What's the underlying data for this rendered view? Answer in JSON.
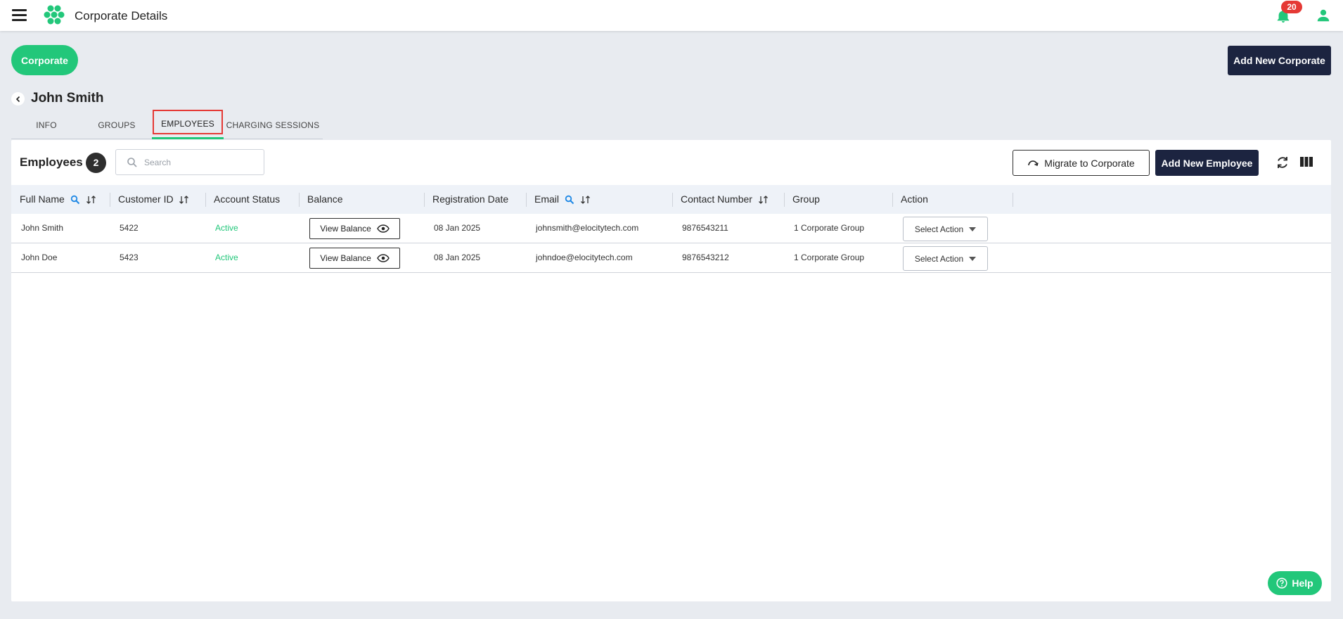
{
  "app": {
    "title": "Corporate Details",
    "notification_count": "20"
  },
  "header": {
    "corporate_label": "Corporate",
    "add_corporate_label": "Add New Corporate"
  },
  "profile": {
    "name": "John Smith"
  },
  "tabs": [
    {
      "label": "INFO"
    },
    {
      "label": "GROUPS"
    },
    {
      "label": "EMPLOYEES"
    },
    {
      "label": "CHARGING SESSIONS"
    }
  ],
  "active_tab": "EMPLOYEES",
  "employees": {
    "title": "Employees",
    "count": "2",
    "search_placeholder": "Search",
    "migrate_label": "Migrate to Corporate",
    "add_label": "Add New Employee",
    "columns": [
      "Full Name",
      "Customer ID",
      "Account Status",
      "Balance",
      "Registration Date",
      "Email",
      "Contact Number",
      "Group",
      "Action"
    ],
    "rows": [
      {
        "full_name": "John Smith",
        "customer_id": "5422",
        "status": "Active",
        "balance_label": "View Balance",
        "registration_date": "08 Jan 2025",
        "email": "johnsmith@elocitytech.com",
        "contact": "9876543211",
        "group": "1 Corporate Group",
        "action_label": "Select Action"
      },
      {
        "full_name": "John Doe",
        "customer_id": "5423",
        "status": "Active",
        "balance_label": "View Balance",
        "registration_date": "08 Jan 2025",
        "email": "johndoe@elocitytech.com",
        "contact": "9876543212",
        "group": "1 Corporate Group",
        "action_label": "Select Action"
      }
    ]
  },
  "help": {
    "label": "Help"
  },
  "colors": {
    "accent": "#22c77a",
    "navy": "#1c2440",
    "danger": "#e53935"
  }
}
